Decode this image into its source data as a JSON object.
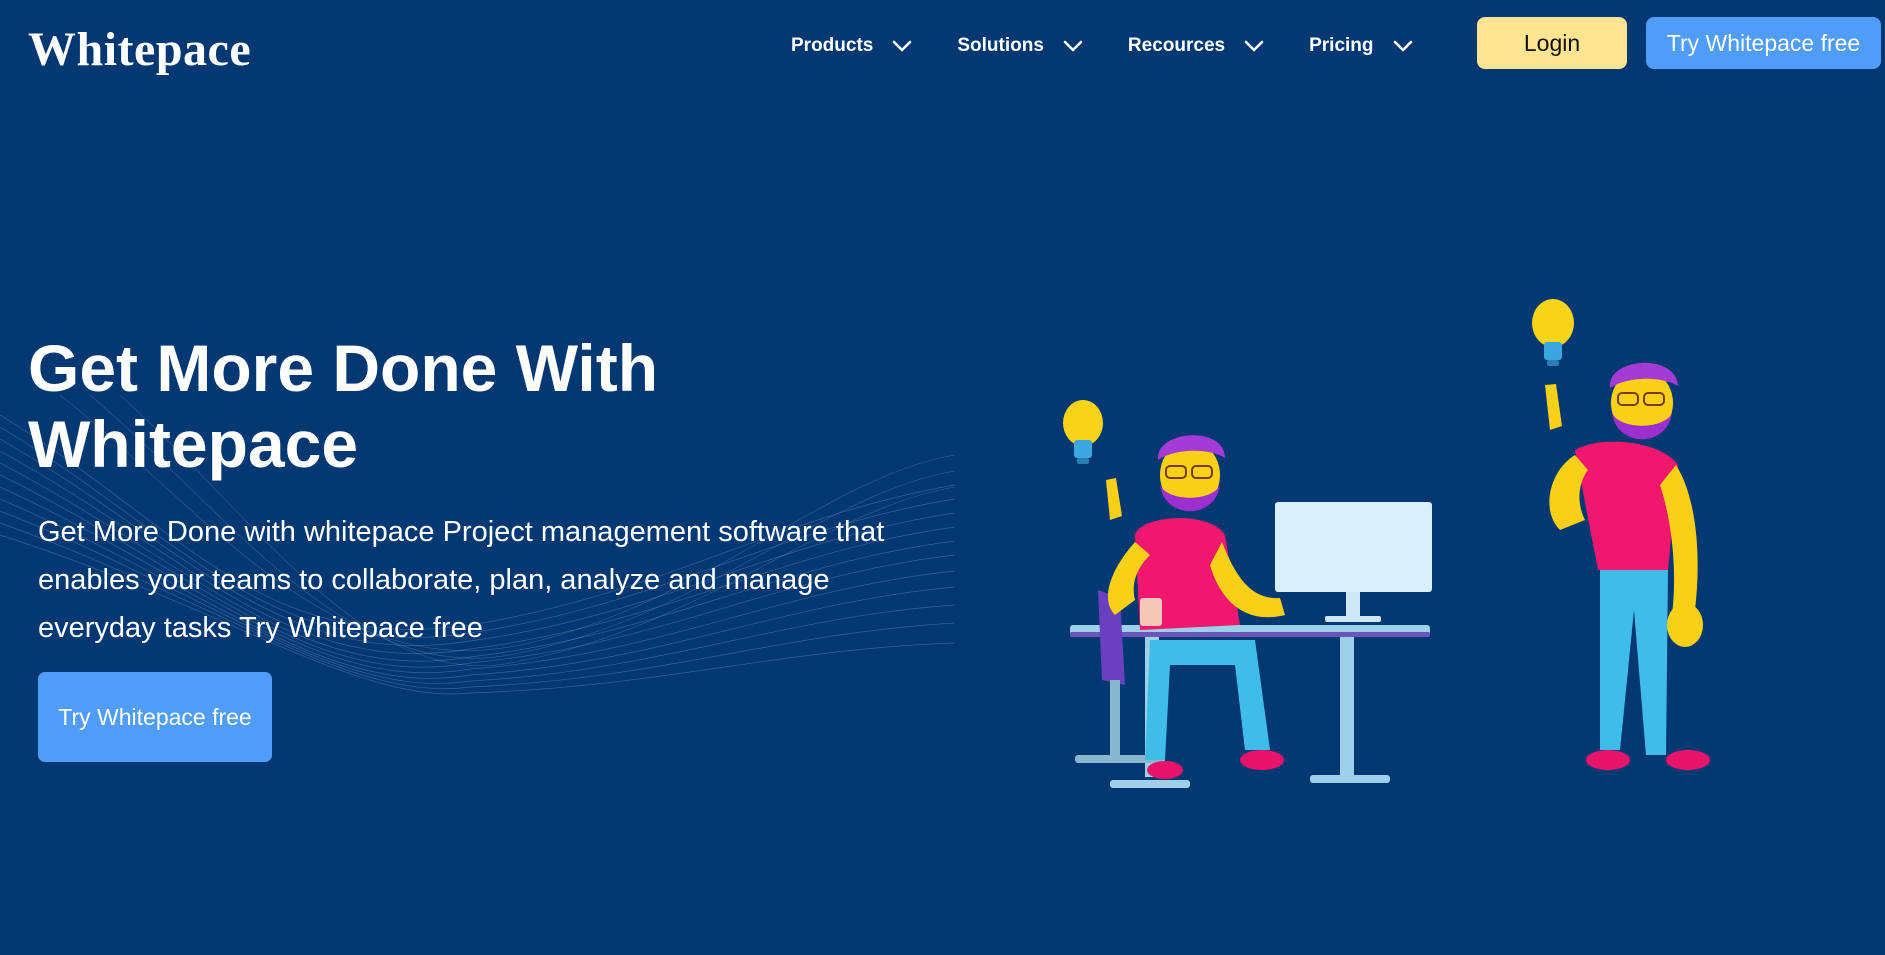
{
  "header": {
    "logo": "Whitepace",
    "nav": [
      {
        "label": "Products"
      },
      {
        "label": "Solutions"
      },
      {
        "label": "Recources"
      },
      {
        "label": "Pricing"
      }
    ],
    "login_label": "Login",
    "try_label": "Try Whitepace free"
  },
  "hero": {
    "title": "Get More Done With Whitepace",
    "subtitle": "Get More Done with whitepace Project management software that enables your teams to collaborate, plan, analyze and manage everyday tasks Try Whitepace free",
    "cta_label": "Try Whitepace free"
  },
  "colors": {
    "background": "#043873",
    "primary_button": "#4f9cf9",
    "login_button": "#ffe492",
    "text": "#ffffff"
  },
  "icons": {
    "nav_dropdown": "chevron-down-icon",
    "illustration": "people-with-lightbulbs-illustration"
  }
}
